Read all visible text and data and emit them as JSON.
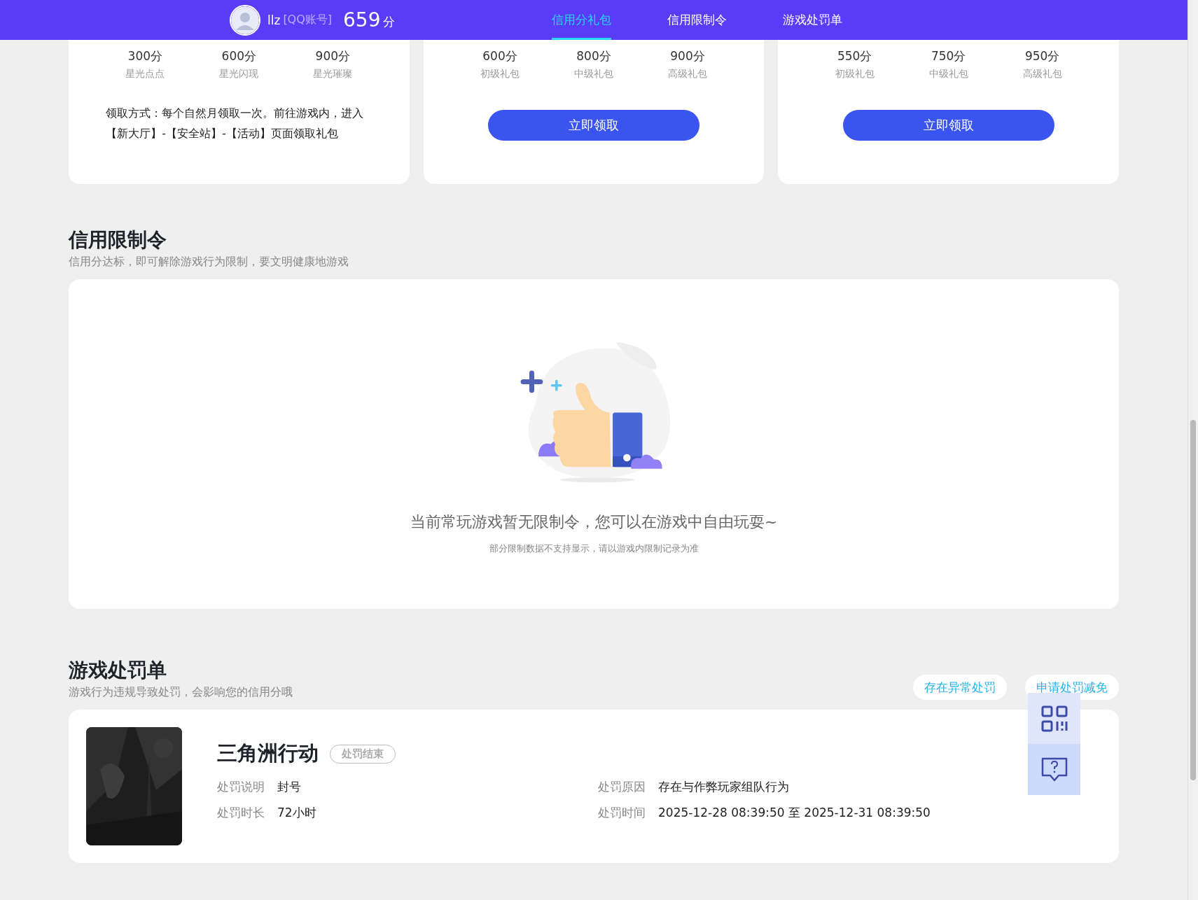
{
  "header": {
    "username": "llz",
    "account_type": "[QQ账号]",
    "score": "659",
    "score_unit": "分",
    "tabs": [
      {
        "label": "信用分礼包",
        "selected": true
      },
      {
        "label": "信用限制令",
        "selected": false
      },
      {
        "label": "游戏处罚单",
        "selected": false
      }
    ]
  },
  "gift_cards": [
    {
      "kind": "note",
      "tiers": [
        {
          "score": "300分",
          "name": "星光点点"
        },
        {
          "score": "600分",
          "name": "星光闪现"
        },
        {
          "score": "900分",
          "name": "星光璀璨"
        }
      ],
      "note": "领取方式：每个自然月领取一次。前往游戏内，进入【新大厅】-【安全站】-【活动】页面领取礼包"
    },
    {
      "kind": "button",
      "tiers": [
        {
          "score": "600分",
          "name": "初级礼包"
        },
        {
          "score": "800分",
          "name": "中级礼包"
        },
        {
          "score": "900分",
          "name": "高级礼包"
        }
      ],
      "button": "立即领取"
    },
    {
      "kind": "button",
      "tiers": [
        {
          "score": "550分",
          "name": "初级礼包"
        },
        {
          "score": "750分",
          "name": "中级礼包"
        },
        {
          "score": "950分",
          "name": "高级礼包"
        }
      ],
      "button": "立即领取"
    }
  ],
  "restriction": {
    "title": "信用限制令",
    "subtitle": "信用分达标，即可解除游戏行为限制，要文明健康地游戏",
    "empty_title": "当前常玩游戏暂无限制令，您可以在游戏中自由玩耍~",
    "empty_note": "部分限制数据不支持显示，请以游戏内限制记录为准"
  },
  "penalty": {
    "title": "游戏处罚单",
    "subtitle": "游戏行为违规导致处罚，会影响您的信用分哦",
    "actions": [
      "存在异常处罚",
      "申请处罚减免"
    ],
    "records": [
      {
        "game": "三角洲行动",
        "status": "处罚结束",
        "fields": [
          {
            "label": "处罚说明",
            "value": "封号"
          },
          {
            "label": "处罚原因",
            "value": "存在与作弊玩家组队行为"
          },
          {
            "label": "处罚时长",
            "value": "72小时"
          },
          {
            "label": "处罚时间",
            "value": "2025-12-28 08:39:50 至 2025-12-31 08:39:50"
          }
        ]
      }
    ]
  }
}
